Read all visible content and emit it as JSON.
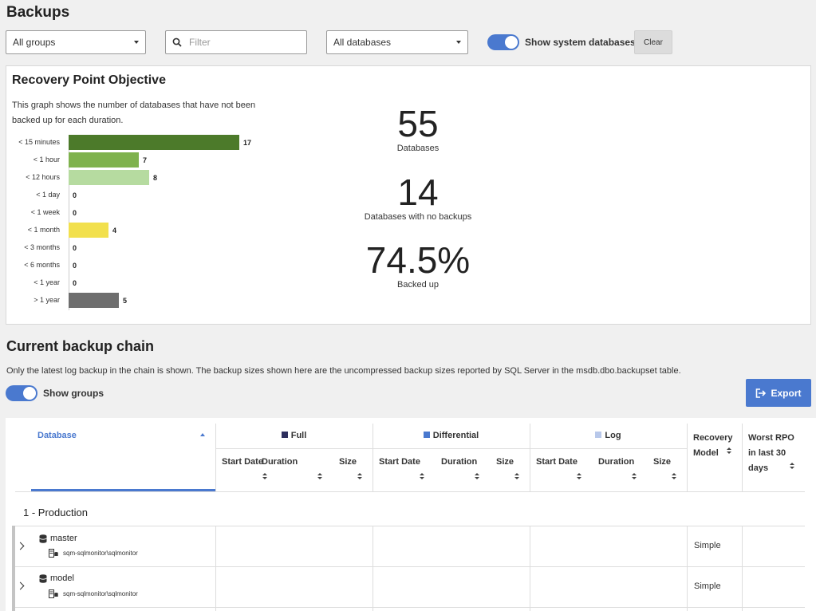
{
  "page": {
    "title": "Backups"
  },
  "toolbar": {
    "group_select": "All groups",
    "filter_placeholder": "Filter",
    "database_select": "All databases",
    "show_system_label": "Show system databases",
    "clear_label": "Clear"
  },
  "rpo": {
    "title": "Recovery Point Objective",
    "description": "This graph shows the number of databases that have not been backed up for each duration.",
    "stats": [
      {
        "value": "55",
        "label": "Databases"
      },
      {
        "value": "14",
        "label": "Databases with no backups"
      },
      {
        "value": "74.5%",
        "label": "Backed up"
      }
    ]
  },
  "chart_data": {
    "type": "bar",
    "orientation": "horizontal",
    "title": "",
    "categories": [
      "< 15 minutes",
      "< 1 hour",
      "< 12 hours",
      "< 1 day",
      "< 1 week",
      "< 1 month",
      "< 3 months",
      "< 6 months",
      "< 1 year",
      "> 1 year"
    ],
    "values": [
      17,
      7,
      8,
      0,
      0,
      4,
      0,
      0,
      0,
      5
    ],
    "colors": [
      "#4c7a2a",
      "#7fb24e",
      "#b6dba0",
      "#cccccc",
      "#cccccc",
      "#f2e04d",
      "#cccccc",
      "#cccccc",
      "#cccccc",
      "#6e6e6e"
    ],
    "data_labels": true,
    "grid": false
  },
  "chain": {
    "title": "Current backup chain",
    "description": "Only the latest log backup in the chain is shown. The backup sizes shown here are the uncompressed backup sizes reported by SQL Server in the msdb.dbo.backupset table.",
    "show_groups_label": "Show groups",
    "export_label": "Export"
  },
  "table": {
    "database_header": "Database",
    "groups": [
      {
        "label": "Full",
        "color": "#2d2f5e"
      },
      {
        "label": "Differential",
        "color": "#4a79cf"
      },
      {
        "label": "Log",
        "color": "#b8c8ea"
      }
    ],
    "sub_headers": [
      "Start Date",
      "Duration",
      "Size"
    ],
    "recovery_model_header": "Recovery Model",
    "worst_rpo_header": "Worst RPO in last 30 days",
    "group_row": "1 - Production",
    "rows": [
      {
        "name": "master",
        "instance": "sqm-sqlmonitor\\sqlmonitor",
        "recovery_model": "Simple"
      },
      {
        "name": "model",
        "instance": "sqm-sqlmonitor\\sqlmonitor",
        "recovery_model": "Simple"
      }
    ]
  }
}
